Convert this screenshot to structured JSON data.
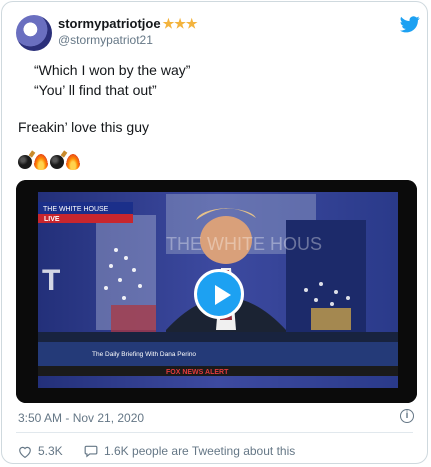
{
  "tweet": {
    "display_name": "stormypatriotjoe",
    "name_badges": "★★★",
    "handle": "@stormypatriot21",
    "quote_line_1": "“Which I won by the way”",
    "quote_line_2": "“You’ ll find that out”",
    "body_line": "Freakin’  love this guy",
    "emoji": [
      "bomb",
      "fire",
      "bomb",
      "fire"
    ],
    "timestamp": "3:50 AM - Nov 21, 2020",
    "likes": "5.3K",
    "tweeting_about": "1.6K people are Tweeting about this"
  },
  "media": {
    "type": "video",
    "tv_caption_top": "THE WHITE HOUSE",
    "tv_caption_live": "LIVE",
    "tv_bg_text": "THE WHITE HOUS",
    "tv_big_letter": "T",
    "tv_lower_third": "The Daily Briefing With Dana Perino",
    "tv_alert": "FOX NEWS ALERT"
  },
  "colors": {
    "accent": "#1da1f2",
    "muted": "#657786",
    "border": "#cfd9de",
    "star": "#f3b33d"
  },
  "icons": {
    "brand": "twitter-bird-icon",
    "play": "play-icon",
    "info": "info-icon",
    "like": "heart-icon",
    "reply": "speech-bubble-icon"
  }
}
